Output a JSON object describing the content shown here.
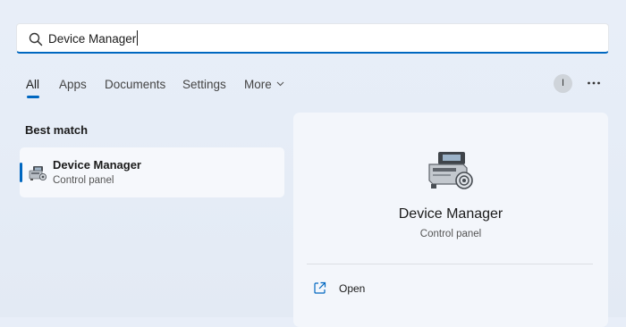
{
  "search": {
    "value": "Device Manager"
  },
  "tabs": [
    {
      "label": "All",
      "active": true
    },
    {
      "label": "Apps"
    },
    {
      "label": "Documents"
    },
    {
      "label": "Settings"
    },
    {
      "label": "More"
    }
  ],
  "account": {
    "initial": "I"
  },
  "menu_icon": "ellipsis-icon",
  "best_match": {
    "heading": "Best match",
    "item": {
      "title": "Device Manager",
      "subtitle": "Control panel",
      "icon": "device-manager-icon"
    }
  },
  "preview": {
    "title": "Device Manager",
    "subtitle": "Control panel",
    "actions": [
      {
        "label": "Open",
        "icon": "open-external-icon"
      }
    ]
  },
  "colors": {
    "accent": "#0067c0",
    "background": "#e6edf7",
    "panel": "#f3f6fb"
  }
}
